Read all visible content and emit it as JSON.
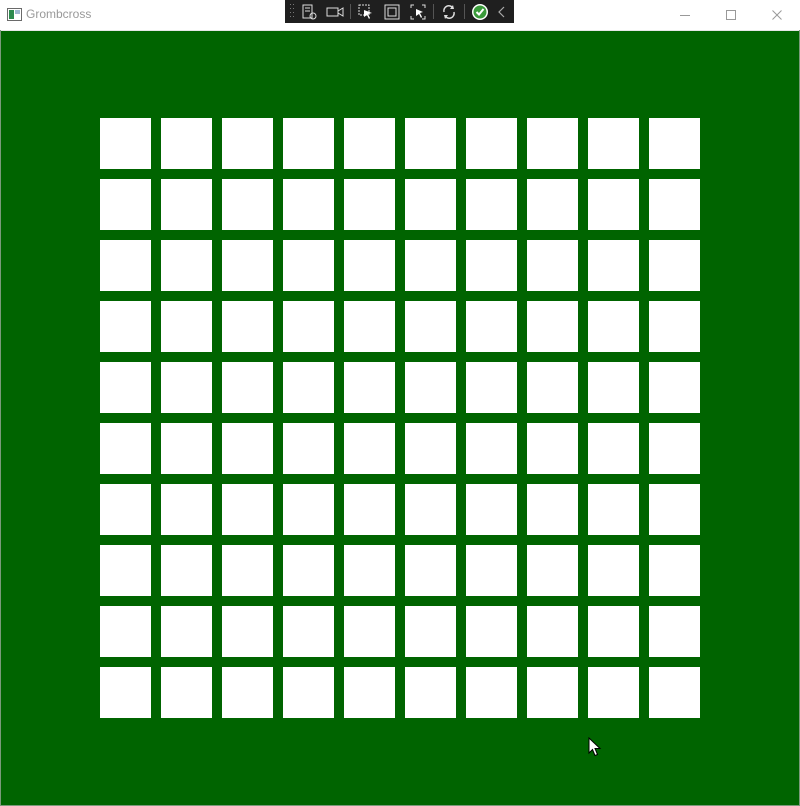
{
  "window": {
    "title": "Grombcross",
    "icon": "app-window-icon",
    "controls": [
      "minimize-icon",
      "maximize-icon",
      "close-icon"
    ]
  },
  "devtools_toolbar": {
    "buttons": [
      "live-visual-tree-icon",
      "record-icon",
      "select-element-icon",
      "display-layout-adorners-icon",
      "track-focus-icon",
      "hot-reload-icon",
      "binding-ok-icon",
      "collapse-chevron-icon"
    ]
  },
  "board": {
    "rows": 10,
    "columns": 10,
    "background_color": "#006400",
    "cell_color": "#ffffff"
  },
  "cursor": "mouse-pointer-icon"
}
